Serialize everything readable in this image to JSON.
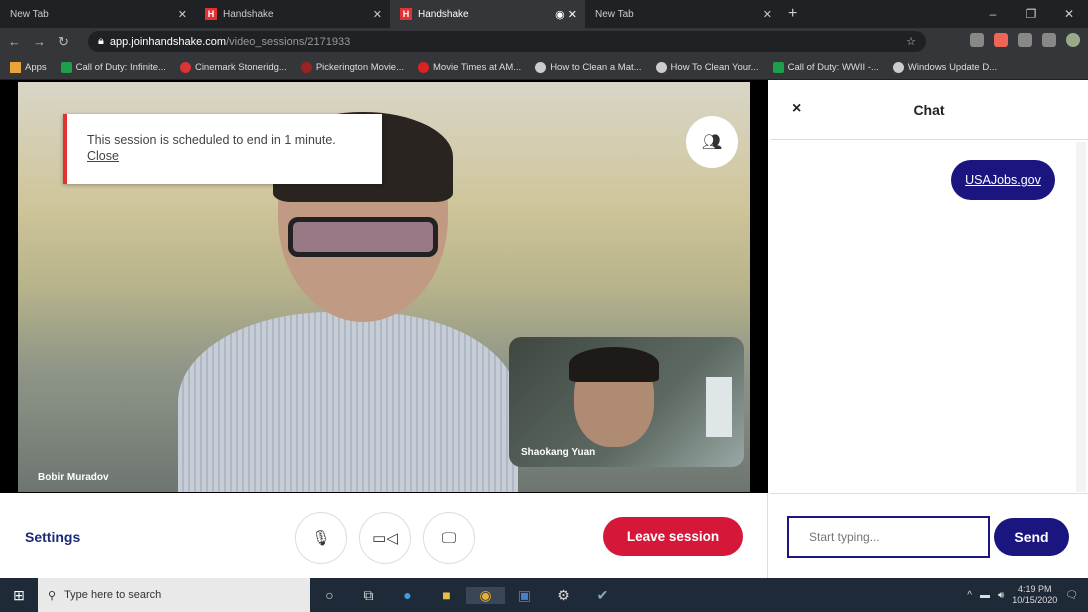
{
  "browser": {
    "tabs": [
      {
        "label": "New Tab",
        "active": false
      },
      {
        "label": "Handshake",
        "active": false,
        "icon": "handshake-icon"
      },
      {
        "label": "Handshake",
        "active": true,
        "icon": "handshake-icon"
      },
      {
        "label": "New Tab",
        "active": false
      }
    ],
    "url_host": "app.joinhandshake.com",
    "url_path": "/video_sessions/2171933",
    "bookmarks": [
      "Apps",
      "Call of Duty: Infinite...",
      "Cinemark Stoneridg...",
      "Pickerington Movie...",
      "Movie Times at AM...",
      "How to Clean a Mat...",
      "How To Clean Your...",
      "Call of Duty: WWII -...",
      "Windows Update D..."
    ]
  },
  "session": {
    "toast": {
      "message": "This session is scheduled to end in 1 minute.",
      "close_label": "Close"
    },
    "main_participant": "Bobir Muradov",
    "pip_participant": "Shaokang Yuan",
    "settings_label": "Settings",
    "leave_label": "Leave session"
  },
  "chat": {
    "title": "Chat",
    "close": "×",
    "messages": [
      {
        "text": "USAJobs.gov",
        "link": true
      }
    ],
    "input_placeholder": "Start typing...",
    "send_label": "Send"
  },
  "taskbar": {
    "search_placeholder": "Type here to search",
    "time": "4:19 PM",
    "date": "10/15/2020"
  },
  "colors": {
    "accent": "#1b1580",
    "leave": "#d5173a",
    "toast_border": "#e03232"
  }
}
